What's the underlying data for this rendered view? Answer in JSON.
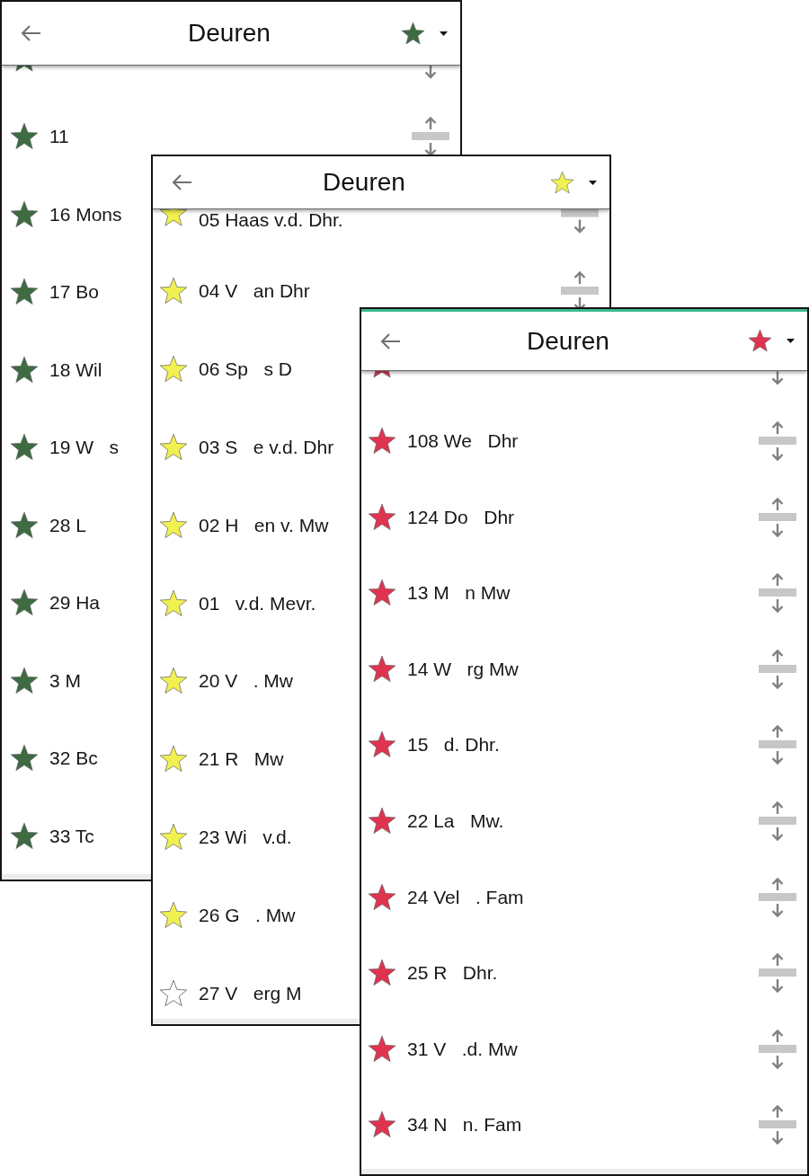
{
  "screens": [
    {
      "title": "Deuren",
      "color": "#3e6b41",
      "rows": [
        {
          "kind": "cut",
          "starred": true,
          "reorder": true
        },
        {
          "kind": "full",
          "label": "11",
          "starred": true,
          "reorder": true
        },
        {
          "kind": "full",
          "label": "16 Mons",
          "starred": true,
          "reorder": false
        },
        {
          "kind": "full",
          "label": "17 Bo",
          "starred": true,
          "reorder": false
        },
        {
          "kind": "full",
          "label": "18 Wil",
          "starred": true,
          "reorder": false
        },
        {
          "kind": "full",
          "label": "19 W   s",
          "starred": true,
          "reorder": false
        },
        {
          "kind": "full",
          "label": "28 L",
          "starred": true,
          "reorder": false
        },
        {
          "kind": "full",
          "label": "29 Ha",
          "starred": true,
          "reorder": false
        },
        {
          "kind": "full",
          "label": "3 M",
          "starred": true,
          "reorder": false
        },
        {
          "kind": "full",
          "label": "32 Bc",
          "starred": true,
          "reorder": false
        },
        {
          "kind": "full",
          "label": "33 Tc",
          "starred": true,
          "reorder": false
        }
      ]
    },
    {
      "title": "Deuren",
      "color": "#f0f050",
      "rows": [
        {
          "kind": "cut",
          "label": "05 Haas v.d. Dhr.",
          "starred": true,
          "reorder": true
        },
        {
          "kind": "full",
          "label": "04 V   an Dhr",
          "starred": true,
          "reorder": true
        },
        {
          "kind": "full",
          "label": "06 Sp   s D",
          "starred": true,
          "reorder": false
        },
        {
          "kind": "full",
          "label": "03 S   e v.d. Dhr",
          "starred": true,
          "reorder": false
        },
        {
          "kind": "full",
          "label": "02 H   en v. Mw",
          "starred": true,
          "reorder": false
        },
        {
          "kind": "full",
          "label": "01   v.d. Mevr.",
          "starred": true,
          "reorder": false
        },
        {
          "kind": "full",
          "label": "20 V   . Mw",
          "starred": true,
          "reorder": false
        },
        {
          "kind": "full",
          "label": "21 R   Mw",
          "starred": true,
          "reorder": false
        },
        {
          "kind": "full",
          "label": "23 Wi   v.d.",
          "starred": true,
          "reorder": false
        },
        {
          "kind": "full",
          "label": "26 G   . Mw",
          "starred": true,
          "reorder": false
        },
        {
          "kind": "full",
          "label": "27 V   erg M",
          "starred": false,
          "reorder": false
        }
      ]
    },
    {
      "title": "Deuren",
      "color": "#e0334f",
      "rows": [
        {
          "kind": "cut",
          "starred": true,
          "reorder": true
        },
        {
          "kind": "full",
          "label": "108 We   Dhr",
          "starred": true,
          "reorder": true
        },
        {
          "kind": "full",
          "label": "124 Do   Dhr",
          "starred": true,
          "reorder": true
        },
        {
          "kind": "full",
          "label": "13 M   n Mw",
          "starred": true,
          "reorder": true
        },
        {
          "kind": "full",
          "label": "14 W   rg Mw",
          "starred": true,
          "reorder": true
        },
        {
          "kind": "full",
          "label": "15   d. Dhr.",
          "starred": true,
          "reorder": true
        },
        {
          "kind": "full",
          "label": "22 La   Mw.",
          "starred": true,
          "reorder": true
        },
        {
          "kind": "full",
          "label": "24 Vel   . Fam",
          "starred": true,
          "reorder": true
        },
        {
          "kind": "full",
          "label": "25 R   Dhr.",
          "starred": true,
          "reorder": true
        },
        {
          "kind": "full",
          "label": "31 V   .d. Mw",
          "starred": true,
          "reorder": true
        },
        {
          "kind": "full",
          "label": "34 N   n. Fam",
          "starred": true,
          "reorder": true
        }
      ]
    }
  ]
}
